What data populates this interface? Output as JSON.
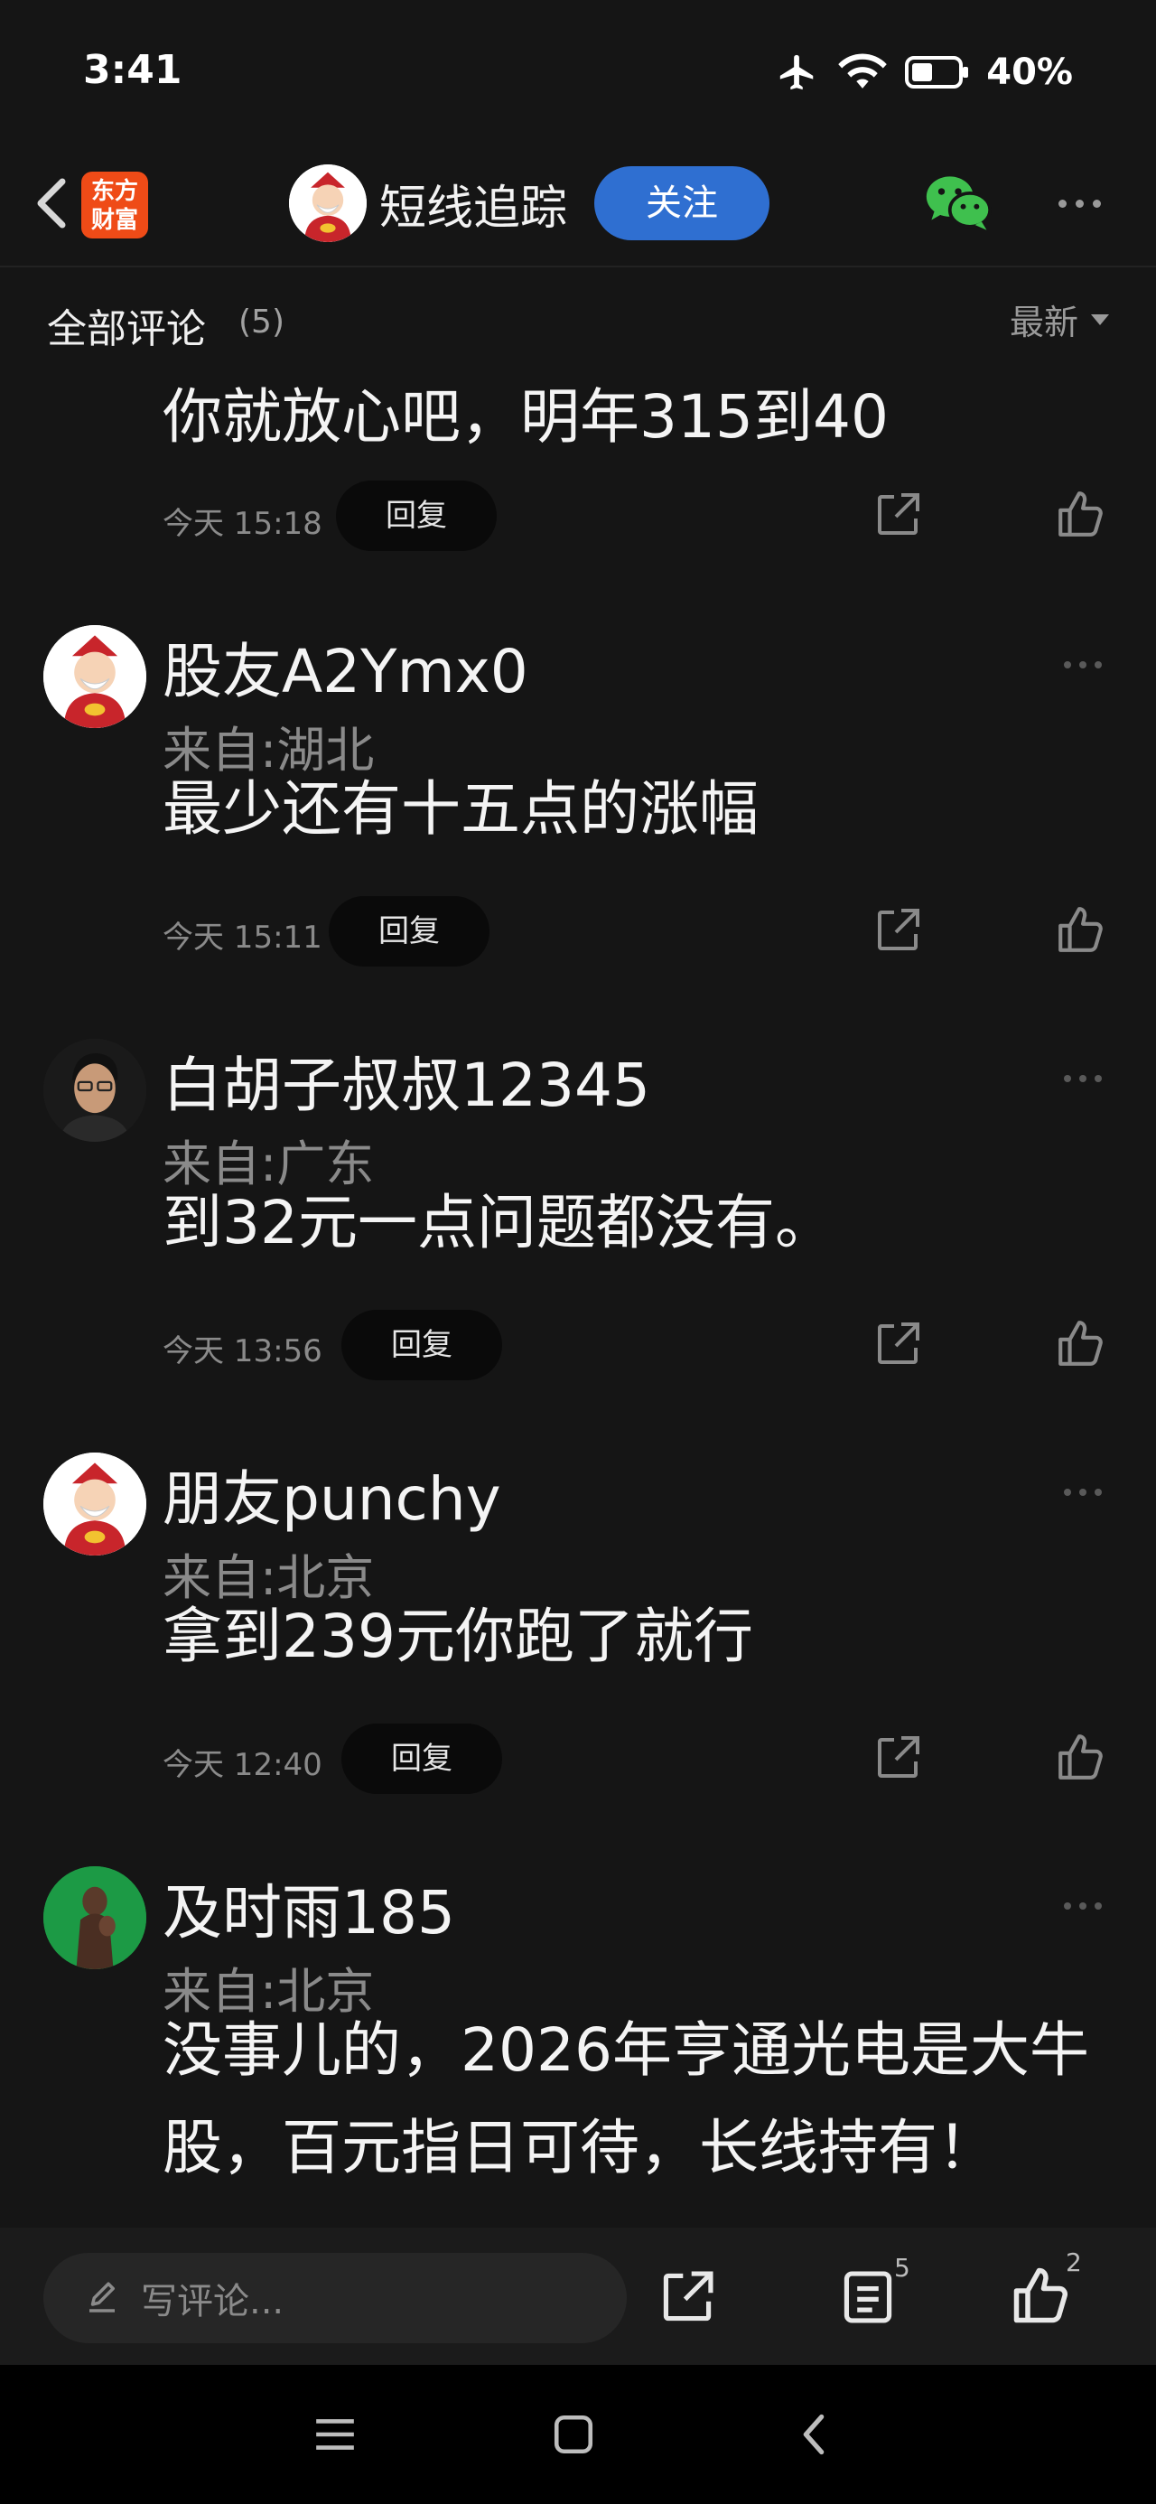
{
  "status_bar": {
    "time": "3:41",
    "battery": "40%"
  },
  "nav": {
    "app_logo": [
      "东方",
      "财富"
    ],
    "channel_name": "短线追踪",
    "follow_label": "关注"
  },
  "comments_header": {
    "title": "全部评论",
    "count": "(5)",
    "sort_label": "最新"
  },
  "comments": [
    {
      "author": "",
      "location": "",
      "text": "你就放心吧，明年315到40",
      "time": "今天 15:18",
      "reply_label": "回复"
    },
    {
      "author": "股友A2Ymx0",
      "location": "来自:湖北",
      "text": "最少还有十五点的涨幅",
      "time": "今天 15:11",
      "reply_label": "回复"
    },
    {
      "author": "白胡子叔叔12345",
      "location": "来自:广东",
      "text": "到32元一点问题都没有。",
      "time": "今天 13:56",
      "reply_label": "回复"
    },
    {
      "author": "朋友punchy",
      "location": "来自:北京",
      "text": "拿到239元你跑了就行",
      "time": "今天 12:40",
      "reply_label": "回复"
    },
    {
      "author": "及时雨185",
      "location": "来自:北京",
      "text": "没事儿的，2026年亨通光电是大牛股，百元指日可待，长线持有！",
      "time": "",
      "reply_label": ""
    }
  ],
  "action_bar": {
    "input_placeholder": "写评论...",
    "comment_count": "5",
    "like_count": "2"
  },
  "colors": {
    "background": "#151515",
    "accent": "#2f6fd1",
    "logo": "#ef4b17",
    "wechat": "#3fc04e"
  }
}
